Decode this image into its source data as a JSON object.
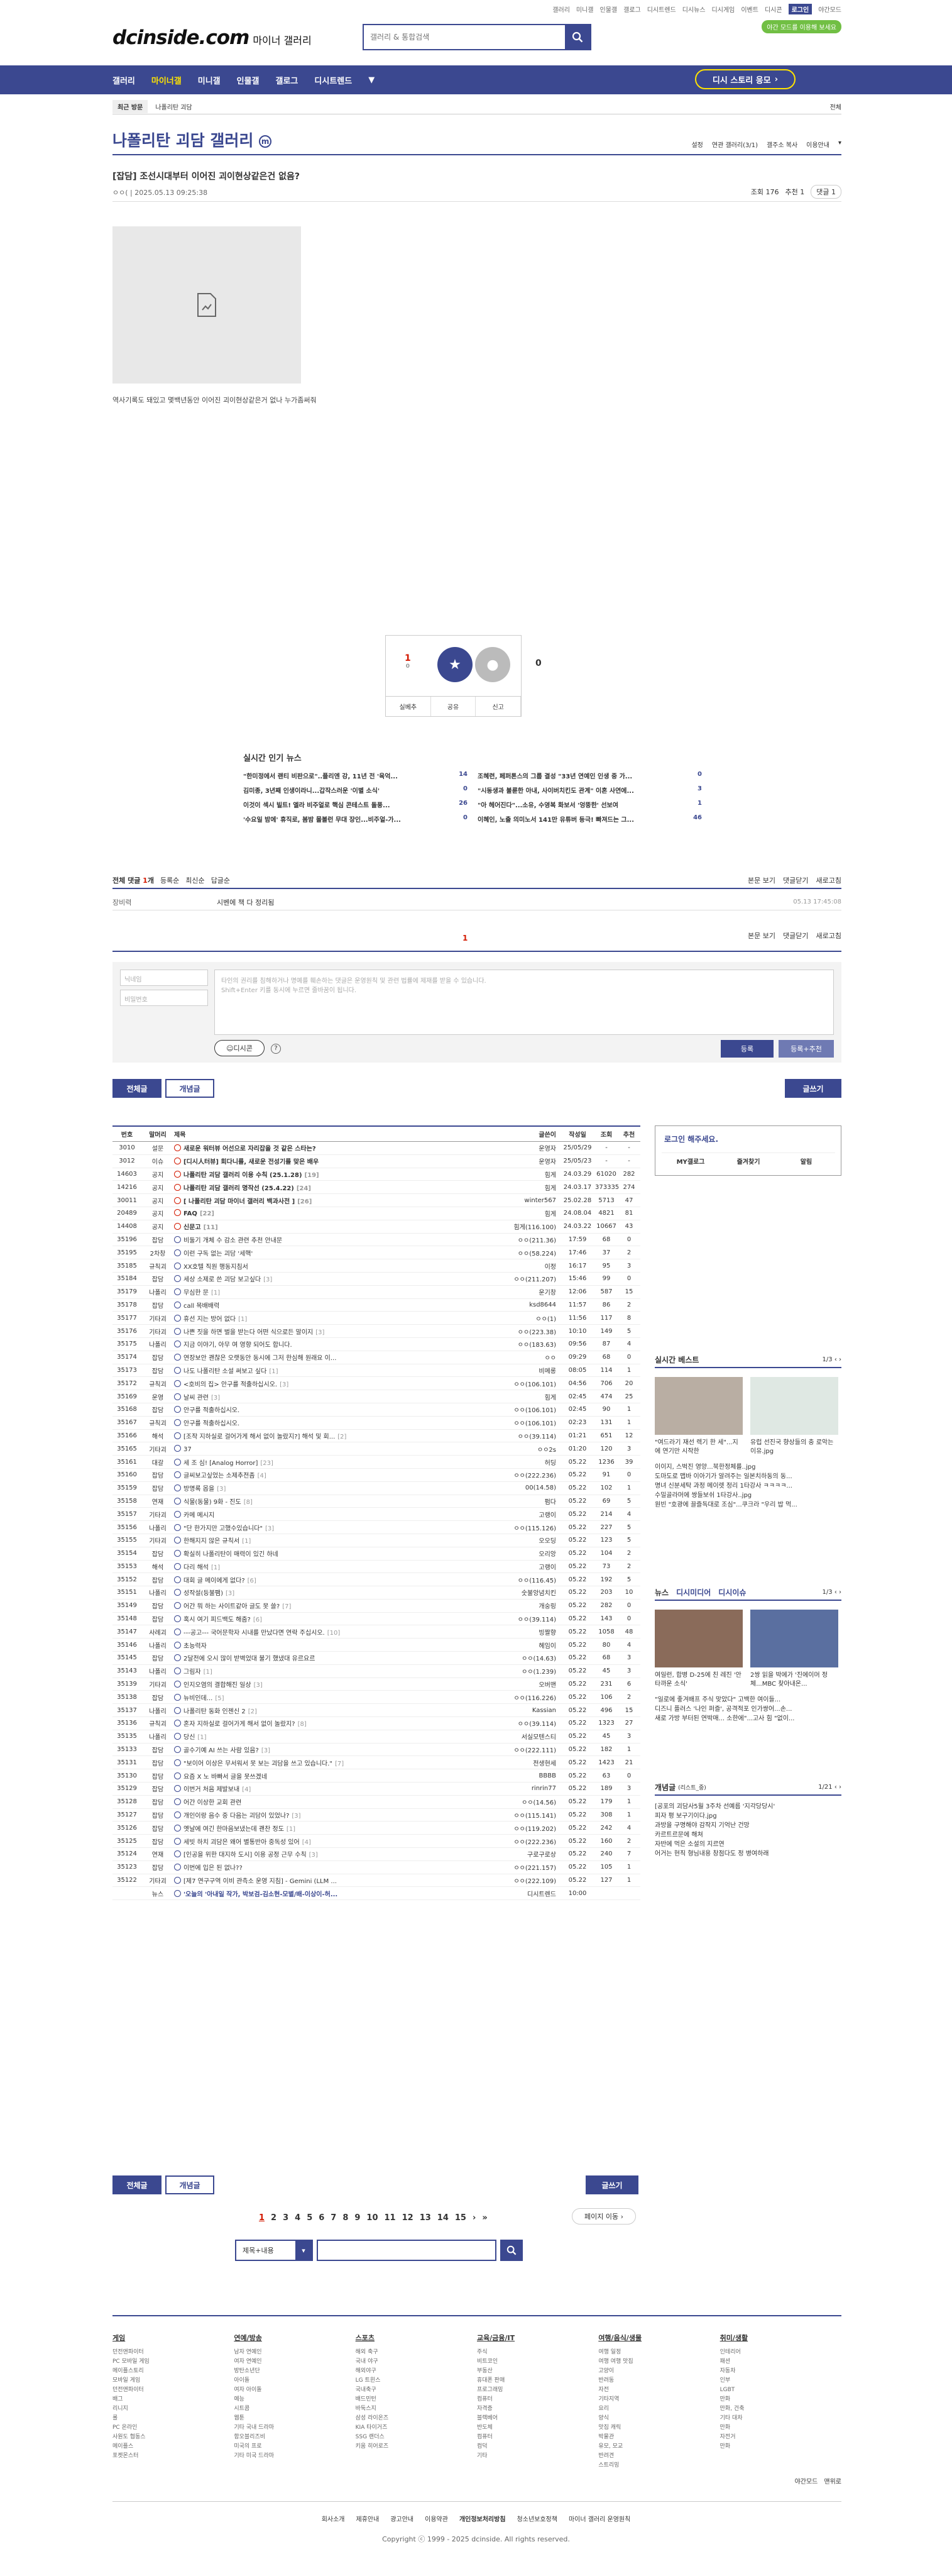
{
  "topnav": {
    "items": [
      "갤러리",
      "미니갤",
      "인물갤",
      "갤로그",
      "디시트렌드",
      "디시뉴스",
      "디시게임",
      "이벤트",
      "디시콘"
    ],
    "login": "로그인",
    "dark": "야간모드",
    "badge": "야간 모드를 이용해 보세요"
  },
  "logo": {
    "brand": "dcinside.com",
    "sub": "마이너 갤러리"
  },
  "search": {
    "placeholder": "갤러리 & 통합검색"
  },
  "gnb": {
    "items": [
      "갤러리",
      "마이너갤",
      "미니갤",
      "인물갤",
      "갤로그",
      "디시트렌드"
    ],
    "story": "디시 스토리 응모"
  },
  "visit": {
    "recent": "최근 방문",
    "recent_gallery": "나폴리탄 괴담",
    "all": "전체"
  },
  "gallery": {
    "title": "나폴리탄 괴담 갤러리",
    "mark": "m",
    "opts": [
      "설정",
      "연관 갤러리(3/1)",
      "갤주소 복사",
      "이용안내"
    ]
  },
  "post": {
    "title": "[잡담] 조선시대부터 이어진 괴이현상같은건 없음?",
    "author": "ㅇㅇ(",
    "date": "2025.05.13 09:25:38",
    "views": "조회 176",
    "rec": "추천 1",
    "comments": "댓글 1",
    "caption": "역사기록도 돼있고 몇백년동안 이어진 괴이현상같은거 없나 누가좀써줘"
  },
  "rec": {
    "up": "1",
    "fix": "0",
    "up_label": "개념",
    "down_label": "비추",
    "down": "0",
    "bar": [
      "실베추",
      "공유",
      "신고"
    ]
  },
  "hotnews": {
    "title": "실시간 인기 뉴스",
    "items": [
      {
        "t": "\"한미정에서 랜티 비판으로\"..플리엔 강, 11년 전 '육억...",
        "n": "14"
      },
      {
        "t": "조혜련, 페퍼톤스의 그룹 결성 \"33년 연예인 인생 중 가...",
        "n": "0"
      },
      {
        "t": "김미종, 3년째 인생이라니...갑작스러운 '이별 소식'",
        "n": "0"
      },
      {
        "t": "\"시동생과 불륜한 아내, 사이버치킨도 관계\" 이혼 사연에...",
        "n": "3"
      },
      {
        "t": "이것이 섹시 빌트! 엘라 비주얼로 핵심 콘테스트 돌풍...",
        "n": "26"
      },
      {
        "t": "\"아 헤어진다\"...소유, 수영복 화보서 '엉뚱한' 선보여",
        "n": "1"
      },
      {
        "t": "'수요일 밤에' 휴직로, 봄밤 몰볼런 무대 장인...비주얼-가...",
        "n": "0"
      },
      {
        "t": "이혜인, 노출 의미노서 141만 유튜버 등극! 빠져드는 그...",
        "n": "46"
      }
    ]
  },
  "comment": {
    "total_label": "전체 댓글",
    "count": "1",
    "unit": "개",
    "sorts": [
      "등록순",
      "최신순",
      "답글순"
    ],
    "right": [
      "본문 보기",
      "댓글닫기",
      "새로고침"
    ],
    "name": "장비력",
    "text": "시벤에 책 다 정리됨",
    "date": "05.13 17:45:08",
    "page": "1",
    "nick_ph": "닉네임",
    "pw_ph": "비밀번호",
    "ta": "타인의 권리를 침해하거나 명예를 훼손하는 댓글은 운영원칙 및 관련 법률에 제재를 받을 수 있습니다.\nShift+Enter 키를 동시에 누르면 줄바꿈이 됩니다.",
    "dccon": "디시콘",
    "reg": "등록",
    "reg2": "등록+추천"
  },
  "tabs": {
    "all": "전체글",
    "best": "개념글",
    "write": "글쓰기"
  },
  "list": {
    "head": [
      "번호",
      "말머리",
      "제목",
      "글쓴이",
      "작성일",
      "조회",
      "추천"
    ],
    "rows": [
      [
        "3010",
        "설문",
        "새로운 워터뷰 어선으로 자리잡을 것 같은 스타는?",
        "운영자",
        "25/05/29",
        "-",
        "-",
        "n"
      ],
      [
        "3012",
        "이슈",
        "[디시人터뷰] 회다니를, 새로운 전성기를 맞은 배우",
        "운영자",
        "25/05/23",
        "-",
        "-",
        "n"
      ],
      [
        "14603",
        "공지",
        "나폴리탄 괴담 갤러리 이용 수칙 (25.1.28)",
        "[19]",
        "힘게",
        "24.03.29",
        "61020",
        "282",
        "n"
      ],
      [
        "14216",
        "공지",
        "나폴리탄 괴담 갤러리 명작선 (25.4.22)",
        "[24]",
        "힘게",
        "24.03.17",
        "373335",
        "274",
        "n"
      ],
      [
        "30011",
        "공지",
        "[ 나폴리탄 괴담 마이너 갤러리 백과사전 ]",
        "[26]",
        "winter567",
        "25.02.28",
        "5713",
        "47",
        "n"
      ],
      [
        "20489",
        "공지",
        "FAQ",
        "[22]",
        "힘게",
        "24.08.04",
        "4821",
        "81",
        "n"
      ],
      [
        "14408",
        "공지",
        "신문고",
        "[11]",
        "힘게(116.100)",
        "24.03.22",
        "10667",
        "43",
        "n"
      ],
      [
        "35196",
        "잡담",
        "비둘기 개체 수 감소 관련 추천 안내문",
        "",
        "ㅇㅇ(211.36)",
        "17:59",
        "68",
        "0",
        "c"
      ],
      [
        "35195",
        "2차창",
        "이런 구독 없는 괴담 '세핵'",
        "",
        "ㅇㅇ(58.224)",
        "17:46",
        "37",
        "2",
        "c"
      ],
      [
        "35185",
        "규칙괴",
        "XX호텔 직원 행동지침서",
        "",
        "이정",
        "16:17",
        "95",
        "3",
        "c"
      ],
      [
        "35184",
        "잡담",
        "세상 소제로 쓴 괴담 보고싶다",
        "[3]",
        "ㅇㅇ(211.207)",
        "15:46",
        "99",
        "0",
        "c"
      ],
      [
        "35179",
        "나폴리",
        "무심한 문",
        "[1]",
        "운기창",
        "12:06",
        "587",
        "15",
        "c"
      ],
      [
        "35178",
        "잡담",
        "call 목배배력",
        "",
        "ksd8644",
        "11:57",
        "86",
        "2",
        "c"
      ],
      [
        "35177",
        "기타괴",
        "휴선 지는 방어 없다",
        "[1]",
        "ㅇㅇ(1)",
        "11:56",
        "117",
        "8",
        "c"
      ],
      [
        "35176",
        "기타괴",
        "나쁜 짓을 하면 벌을 받는다 어떤 식으로든 말이지",
        "[3]",
        "ㅇㅇ(223.38)",
        "10:10",
        "149",
        "5",
        "c"
      ],
      [
        "35175",
        "나폴리",
        "지금 이야기, 아무 여 영향 되어도 합니다.",
        "",
        "ㅇㅇ(183.63)",
        "09:56",
        "87",
        "4",
        "c"
      ],
      [
        "35174",
        "잡담",
        "연장보안 괜찮은 오랫동안 동시에 그저 한심해 원래요 이...",
        "",
        "ㅇㅇ",
        "09:29",
        "68",
        "0",
        "c"
      ],
      [
        "35173",
        "잡담",
        "나도 나폴리탄 소설 써보고 싶다",
        "[1]",
        "비메롱",
        "08:05",
        "114",
        "1",
        "c"
      ],
      [
        "35172",
        "규칙괴",
        "<호비의 집> 안구를 적출하십시오.",
        "[3]",
        "ㅇㅇ(106.101)",
        "04:56",
        "706",
        "20",
        "c"
      ],
      [
        "35169",
        "운영",
        "날씨 관련",
        "[3]",
        "힘게",
        "02:45",
        "474",
        "25",
        "c"
      ],
      [
        "35168",
        "잡담",
        "안구를 적출하십시오.",
        "",
        "ㅇㅇ(106.101)",
        "02:45",
        "90",
        "1",
        "c"
      ],
      [
        "35167",
        "규칙괴",
        "안구를 적출하십시오.",
        "",
        "ㅇㅇ(106.101)",
        "02:23",
        "131",
        "1",
        "c"
      ],
      [
        "35166",
        "해석",
        "[조작 지하실로 걸어가게 해서 없이 놀랐지?] 해석 및 회...",
        "[2]",
        "ㅇㅇ(39.114)",
        "01:21",
        "651",
        "12",
        "c"
      ],
      [
        "35165",
        "기타괴",
        "37",
        "",
        "ㅇㅇ2s",
        "01:20",
        "120",
        "3",
        "c"
      ],
      [
        "35161",
        "대갈",
        "세 조 심! [Analog Horror]",
        "[23]",
        "허딩",
        "05.22",
        "1236",
        "39",
        "c"
      ],
      [
        "35160",
        "잡담",
        "글씨보고싶었는 소제추전좀",
        "[4]",
        "ㅇㅇ(222.236)",
        "05.22",
        "91",
        "0",
        "c"
      ],
      [
        "35159",
        "잡담",
        "방명록 몹을",
        "[3]",
        "00(14.58)",
        "05.22",
        "102",
        "1",
        "c"
      ],
      [
        "35158",
        "연재",
        "식물(동물) 9화 - 진도",
        "[8]",
        "펌다",
        "05.22",
        "69",
        "5",
        "c"
      ],
      [
        "35157",
        "기타괴",
        "카메 메시지",
        "",
        "고랭이",
        "05.22",
        "214",
        "4",
        "c"
      ],
      [
        "35156",
        "나폴리",
        "\"단 한가지만 고했수있습니다\"",
        "[3]",
        "ㅇㅇ(115.126)",
        "05.22",
        "227",
        "5",
        "c"
      ],
      [
        "35155",
        "기타괴",
        "한해지지 않은 규칙서",
        "[1]",
        "오오딩",
        "05.22",
        "123",
        "5",
        "c"
      ],
      [
        "35154",
        "잡담",
        "확실히 나폴리탄이 매력이 있긴 하네",
        "",
        "오리앙",
        "05.22",
        "104",
        "2",
        "c"
      ],
      [
        "35153",
        "해석",
        "다리 해석",
        "[1]",
        "고랭이",
        "05.22",
        "73",
        "2",
        "c"
      ],
      [
        "35152",
        "잡담",
        "대회 글 메이에게 없다?",
        "[6]",
        "ㅇㅇ(116.45)",
        "05.22",
        "192",
        "5",
        "c"
      ],
      [
        "35151",
        "나폴리",
        "성작설(등불팸)",
        "[3]",
        "숫불앙념치킨",
        "05.22",
        "203",
        "10",
        "c"
      ],
      [
        "35149",
        "잡담",
        "어간 뭐 하는 사이트같아 글도 못 쓸?",
        "[7]",
        "개숭링",
        "05.22",
        "282",
        "0",
        "c"
      ],
      [
        "35148",
        "잡담",
        "혹시 여기 피드백도 해줌?",
        "[6]",
        "ㅇㅇ(39.114)",
        "05.22",
        "143",
        "0",
        "c"
      ],
      [
        "35147",
        "사례괴",
        "---공고--- 국어문학자 시내를 만났다면 연락 주십시오.",
        "[10]",
        "빙짤향",
        "05.22",
        "1058",
        "48",
        "c"
      ],
      [
        "35146",
        "나폴리",
        "초능력자",
        "",
        "헤임이",
        "05.22",
        "80",
        "4",
        "c"
      ],
      [
        "35145",
        "잡담",
        "2달전에 오시 많이 받벽었대 불기 했냈대 유르요르",
        "",
        "ㅇㅇ(14.63)",
        "05.22",
        "68",
        "3",
        "c"
      ],
      [
        "35143",
        "나폴리",
        "그림자",
        "[1]",
        "ㅇㅇ(1.239)",
        "05.22",
        "45",
        "3",
        "c"
      ],
      [
        "35139",
        "기타괴",
        "인지오염의 결합해진 일상",
        "[3]",
        "오버맨",
        "05.22",
        "231",
        "6",
        "c"
      ],
      [
        "35138",
        "잡담",
        "뉴비인데...",
        "[5]",
        "ㅇㅇ(116.226)",
        "05.22",
        "106",
        "2",
        "c"
      ],
      [
        "35137",
        "나폴리",
        "나폴리탄 동화 인젠신 2",
        "[2]",
        "Kassian",
        "05.22",
        "496",
        "15",
        "c"
      ],
      [
        "35136",
        "규칙괴",
        "혼자 지하실로 걸어가게 해서 없이 놀랐지?",
        "[8]",
        "ㅇㅇ(39.114)",
        "05.22",
        "1323",
        "27",
        "c"
      ],
      [
        "35135",
        "나폴리",
        "당신",
        "[1]",
        "서실모텐스티",
        "05.22",
        "45",
        "3",
        "c"
      ],
      [
        "35133",
        "잡담",
        "골수기예 AI 쓰는 사람 있음?",
        "[3]",
        "ㅇㅇ(222.111)",
        "05.22",
        "182",
        "1",
        "c"
      ],
      [
        "35131",
        "잡담",
        "\"보이어 이상은 무서워서 못 보는 괴담을 쓰고 있습니다.\"",
        "[7]",
        "전생현세",
        "05.22",
        "1423",
        "21",
        "c"
      ],
      [
        "35130",
        "잡담",
        "요즘 X 노 바빠서 글을 못쓰겠네",
        "",
        "BBBB",
        "05.22",
        "63",
        "0",
        "c"
      ],
      [
        "35129",
        "잡담",
        "이번거 처음 제발보내",
        "[4]",
        "rinrin77",
        "05.22",
        "189",
        "3",
        "c"
      ],
      [
        "35128",
        "잡담",
        "어간 이상한 교회 관련",
        "",
        "ㅇㅇ(14.56)",
        "05.22",
        "179",
        "1",
        "c"
      ],
      [
        "35127",
        "잡담",
        "개인이랑 음수 중 다음는 괴담이 있었나?",
        "[3]",
        "ㅇㅇ(115.141)",
        "05.22",
        "308",
        "1",
        "c"
      ],
      [
        "35126",
        "잡담",
        "옛날에 여긴 한마음보냈는데 괜찬 정도",
        "[1]",
        "ㅇㅇ(119.202)",
        "05.22",
        "242",
        "4",
        "c"
      ],
      [
        "35125",
        "잡담",
        "세빗 하치 괴담은 왜어 별통반아 중독성 있어",
        "[4]",
        "ㅇㅇ(222.236)",
        "05.22",
        "160",
        "2",
        "c"
      ],
      [
        "35124",
        "연재",
        "[인공을 위한 대지하 도시] 이용 공정 근무 수칙",
        "[3]",
        "구로구로상",
        "05.22",
        "240",
        "7",
        "c"
      ],
      [
        "35123",
        "잡담",
        "이번에 입은 된 없나??",
        "",
        "ㅇㅇ(221.157)",
        "05.22",
        "105",
        "1",
        "c"
      ],
      [
        "35122",
        "기타괴",
        "[제7 연구구역 이비 관측소 운영 지침] - Gemini (LLM ...",
        "",
        "ㅇㅇ(222.109)",
        "05.22",
        "127",
        "1",
        "c"
      ],
      [
        "",
        "뉴스",
        "'오늘의 '아내일 작가, 박보검-김소현-모별/배-이상이-허...",
        "",
        "디시트렌드",
        "10:00",
        "",
        "",
        "w"
      ]
    ]
  },
  "right": {
    "login_t": "로그인 해주세요.",
    "login_b": [
      "MY갤로그",
      "즐겨찾기",
      "알림"
    ],
    "best_t": "실시간 베스트",
    "best_pg": "1/3",
    "best_caps": [
      "\"여드라기 재선 렉기 한 세\"...지에 연기만 시작한",
      "유럽 선진국 향상들의 충 로악는 이유.jpg"
    ],
    "best_list": [
      "이이지, 스벅진 영양...북한정체를..jpg",
      "도마도로 맵바 이아기가 알려주는 일본치하동의 동...",
      "명녀 신분세탁 과정 메이렛 정리 1타강사 ㅋㅋㅋㅋ...",
      "수밀골라머에 쌍들보쉬 1타강사..jpg",
      "원빈 \"호광에 끌즐독대로 조심\"...쿠크라 \"우리 밥 먹..."
    ],
    "news_tabs": [
      "뉴스",
      "디시미디어",
      "디시이슈"
    ],
    "news_pg": "1/3",
    "news_caps": [
      "여일런, 합병 D-25에 친 레진 '안타까운 소식'",
      "2쌍 읽을 박에가 '진에이머 정체...MBC 찾아내온..."
    ],
    "news_list": [
      "\"일로에 좋겨배프 주식 맞았다\" 고백한 여이들...",
      "디즈니 플러스 '나인 퍼즐', 공격적포 인가쌍어...손...",
      "새로 가방 부터된 연박매... 소한에\"...고사 힘 \"없이..."
    ],
    "concept_t": "개념글",
    "concept_sub": "(리스트_중)",
    "concept_pg": "1/21",
    "concept_list": [
      "[공포의 괴담사5월 3주차 선예름 '지각당당시'",
      "피자 평 보구기이다.jpg",
      "과방을 구명해야 감작지 기억난 건망",
      "카르트르문에 해쳐",
      "자반에 먹은 소설의 지르연",
      "어거는 현직 형님내용 창점다도 정 병여하래"
    ]
  },
  "pager": {
    "pages": [
      "1",
      "2",
      "3",
      "4",
      "5",
      "6",
      "7",
      "8",
      "9",
      "10",
      "11",
      "12",
      "13",
      "14",
      "15"
    ],
    "jump": "페이지 이동"
  },
  "bsearch": {
    "sel": "제목+내용"
  },
  "footer": {
    "cols": [
      {
        "h": "게임",
        "items": [
          "던전앤파이터",
          "PC 모바일 게임",
          "메이플스토리",
          "모바일 게임",
          "던전앤파이터",
          "배그",
          "리니지",
          "롤",
          "PC 온라인",
          "사원도 협동스",
          "메이플스",
          "포켓몬스터"
        ]
      },
      {
        "h": "연예/방송",
        "items": [
          "남자 연예인",
          "여자 연예인",
          "방탄소년단",
          "아이돌",
          "여자 아이돌",
          "예능",
          "시트콤",
          "웹툰",
          "기타 국내 드라마",
          "함오블리즈비",
          "미국의 프로",
          "기타 미국 드라마"
        ]
      },
      {
        "h": "스포츠",
        "items": [
          "해외 축구",
          "국내 야구",
          "해외야구",
          "LG 트윈스",
          "국내축구",
          "배드민턴",
          "바둑스지",
          "삼성 라이온즈",
          "KIA 타이거즈",
          "SSG 랜더스",
          "키움 히어로즈"
        ]
      },
      {
        "h": "교육/금융/IT",
        "items": [
          "주식",
          "비트코인",
          "부동산",
          "휴대폰 판매",
          "프로그래밍",
          "컴퓨터",
          "자격증",
          "블랙베어",
          "반도체",
          "컴퓨터",
          "컴덕",
          "기타"
        ]
      },
      {
        "h": "여행/음식/생물",
        "items": [
          "여행 일정",
          "여행 여행 맛집",
          "고양이",
          "반려동",
          "자전",
          "기타지역",
          "요리",
          "양식",
          "맛집 캐릭",
          "박물관",
          "유모, 모교",
          "반려견",
          "스트리밍"
        ]
      },
      {
        "h": "취미/생활",
        "items": [
          "인테리어",
          "패션",
          "자동차",
          "인부",
          "LGBT",
          "만화",
          "만화, 건축",
          "기타 대차",
          "만화",
          "자전거",
          "만화"
        ]
      }
    ],
    "bl": [
      "야간모드",
      "맨위로"
    ],
    "links": [
      "회사소개",
      "제휴안내",
      "광고안내",
      "이용약관",
      "개인정보처리방침",
      "청소년보호정책",
      "마이너 갤러리 운영원칙"
    ],
    "copy": "Copyright ⓒ 1999 - 2025 dcinside. All rights reserved."
  }
}
